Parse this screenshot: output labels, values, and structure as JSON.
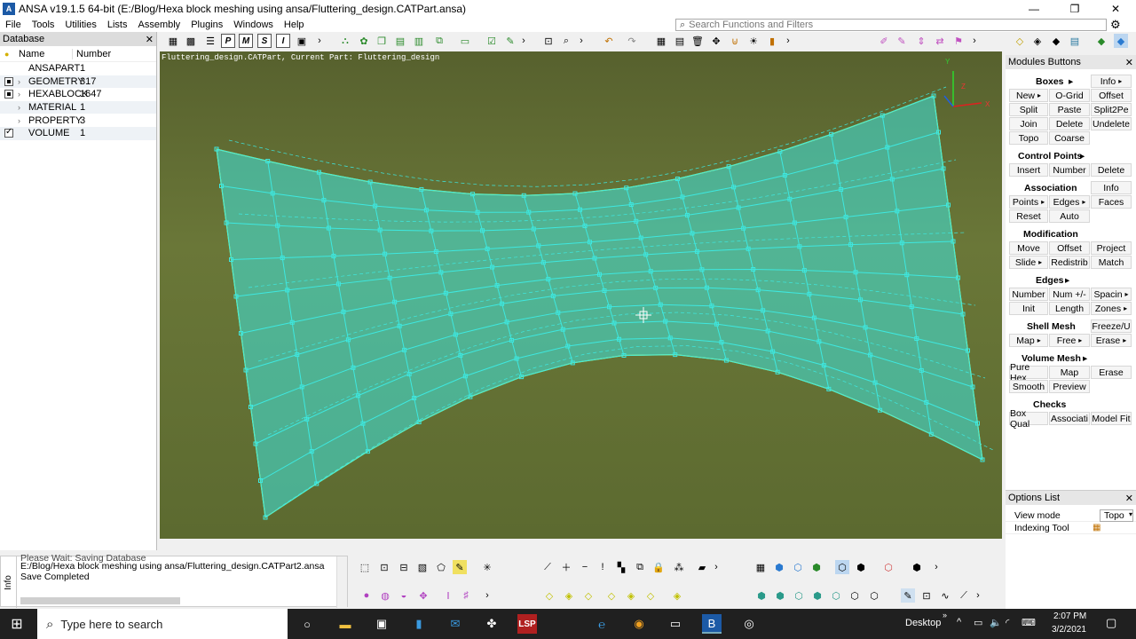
{
  "window": {
    "title": "ANSA v19.1.5 64-bit (E:/Blog/Hexa block meshing using ansa/Fluttering_design.CATPart.ansa)",
    "app_icon_label": "A",
    "controls": {
      "minimize": "—",
      "maximize": "❐",
      "close": "✕"
    }
  },
  "menu": [
    "File",
    "Tools",
    "Utilities",
    "Lists",
    "Assembly",
    "Plugins",
    "Windows",
    "Help"
  ],
  "search": {
    "placeholder": "Search Functions and Filters"
  },
  "database_panel": {
    "title": "Database",
    "close": "✕",
    "col_name": "Name",
    "col_number": "Number",
    "rows": [
      {
        "name": "ANSAPART",
        "number": "1"
      },
      {
        "name": "GEOMETRY",
        "number": "317"
      },
      {
        "name": "HEXABLOCK",
        "number": "1647"
      },
      {
        "name": "MATERIAL",
        "number": "1"
      },
      {
        "name": "PROPERTY",
        "number": "3"
      },
      {
        "name": "VOLUME",
        "number": "1"
      }
    ]
  },
  "viewport": {
    "header_text": "Fluttering_design.CATPart,  Current Part: Fluttering_design",
    "axis_y": "Y",
    "axis_x": "X",
    "axis_z": "Z"
  },
  "modules_panel": {
    "title": "Modules Buttons",
    "close": "✕",
    "boxes_header": "Boxes",
    "info": "Info",
    "boxes": [
      "New",
      "O-Grid",
      "Offset",
      "Split",
      "Paste",
      "Split2Pe",
      "Join",
      "Delete",
      "Undelete",
      "Topo",
      "Coarse"
    ],
    "control_points_header": "Control Points",
    "control_points": [
      "Insert",
      "Number",
      "Delete"
    ],
    "association_header": "Association",
    "association_info": "Info",
    "association": [
      "Points",
      "Edges",
      "Faces",
      "Reset",
      "Auto"
    ],
    "modification_header": "Modification",
    "modification": [
      "Move",
      "Offset",
      "Project",
      "Slide",
      "Redistrib",
      "Match"
    ],
    "edges_header": "Edges",
    "edges": [
      "Number",
      "Num +/-",
      "Spacin",
      "Init",
      "Length",
      "Zones"
    ],
    "shell_header": "Shell Mesh",
    "shell_freeze": "Freeze/U",
    "shell": [
      "Map",
      "Free",
      "Erase"
    ],
    "volume_header": "Volume Mesh",
    "volume": [
      "Pure Hex",
      "Map",
      "Erase",
      "Smooth",
      "Preview"
    ],
    "checks_header": "Checks",
    "checks": [
      "Box Qual",
      "Associati",
      "Model Fit"
    ]
  },
  "options_panel": {
    "title": "Options List",
    "close": "✕",
    "rows": [
      {
        "label": "View mode",
        "value": "Topo"
      },
      {
        "label": "Indexing Tool",
        "value": ""
      }
    ]
  },
  "info_panel": {
    "side_label": "Info",
    "lines": [
      "Please Wait: Saving Database",
      "E:/Blog/Hexa block meshing using ansa/Fluttering_design.CATPart2.ansa",
      "Save Completed"
    ]
  },
  "taskbar": {
    "search_placeholder": "Type here to search",
    "desktop_label": "Desktop",
    "time": "2:07 PM",
    "date": "3/2/2021",
    "lsp_label": "LSP"
  },
  "colors": {
    "mesh": "#3ee8e0",
    "viewport_bg": "#5f6b32",
    "edge_highlight": "#c8ff66"
  }
}
